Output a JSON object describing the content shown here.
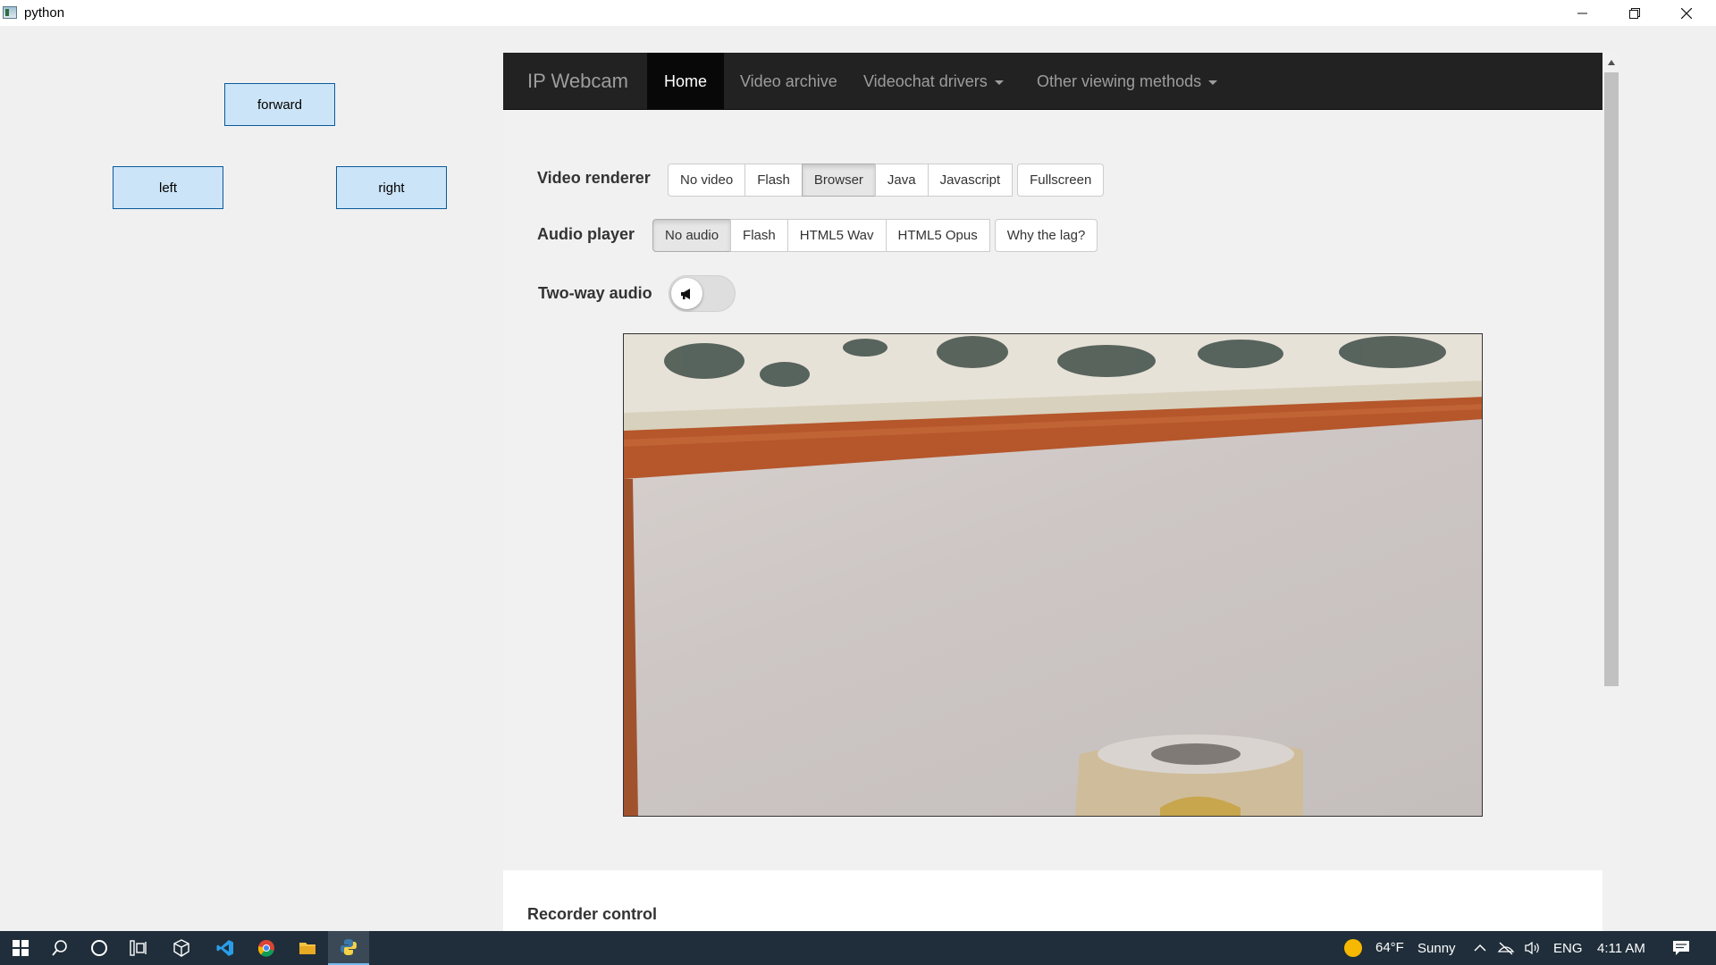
{
  "window": {
    "title": "python"
  },
  "controls": {
    "forward": "forward",
    "left": "left",
    "right": "right"
  },
  "navbar": {
    "brand": "IP Webcam",
    "items": [
      {
        "label": "Home",
        "active": true
      },
      {
        "label": "Video archive"
      },
      {
        "label": "Videochat drivers",
        "dropdown": true
      },
      {
        "label": "Other viewing methods",
        "dropdown": true
      }
    ]
  },
  "video_renderer": {
    "label": "Video renderer",
    "options": [
      "No video",
      "Flash",
      "Browser",
      "Java",
      "Javascript"
    ],
    "selected": "Browser",
    "fullscreen": "Fullscreen"
  },
  "audio_player": {
    "label": "Audio player",
    "options": [
      "No audio",
      "Flash",
      "HTML5 Wav",
      "HTML5 Opus"
    ],
    "selected": "No audio",
    "help": "Why the lag?"
  },
  "two_way_audio": {
    "label": "Two-way audio",
    "enabled": false
  },
  "recorder": {
    "heading": "Recorder control"
  },
  "taskbar": {
    "weather_temp": "64°F",
    "weather_text": "Sunny",
    "language": "ENG",
    "clock": "4:11 AM"
  },
  "colors": {
    "navbar_bg": "#222222",
    "tk_button_bg": "#cce4f7",
    "tk_button_border": "#0b5a9a",
    "taskbar_bg": "#1f2e3a"
  }
}
